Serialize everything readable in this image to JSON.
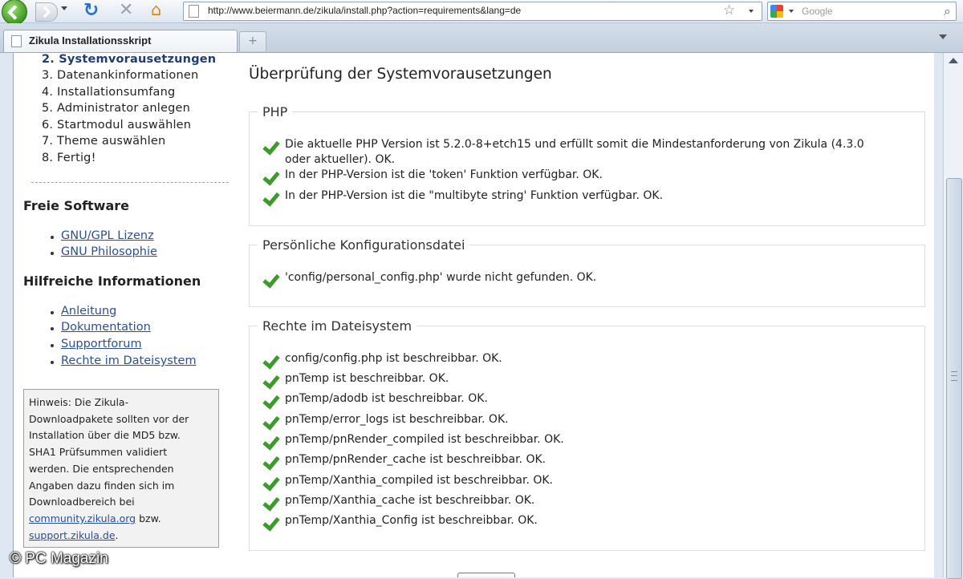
{
  "browser": {
    "url": "http://www.beiermann.de/zikula/install.php?action=requirements&lang=de",
    "search_placeholder": "Google",
    "tab_title": "Zikula Installationsskript",
    "new_tab_symbol": "+"
  },
  "sidebar": {
    "steps": [
      {
        "label": "2. Systemvorausetzungen"
      },
      {
        "label": "3. Datenankinformationen"
      },
      {
        "label": "4. Installationsumfang"
      },
      {
        "label": "5. Administrator anlegen"
      },
      {
        "label": "6. Startmodul auswählen"
      },
      {
        "label": "7. Theme auswählen"
      },
      {
        "label": "8. Fertig!"
      }
    ],
    "free_software": {
      "heading": "Freie Software",
      "links": [
        "GNU/GPL Lizenz",
        "GNU Philosophie"
      ]
    },
    "helpful_info": {
      "heading": "Hilfreiche Informationen",
      "links": [
        "Anleitung",
        "Dokumentation",
        "Supportforum",
        "Rechte im Dateisystem"
      ]
    },
    "note": {
      "lines": [
        "Hinweis: Die Zikula-",
        "Downloadpakete sollten vor der",
        "Installation über die MD5 bzw.",
        "SHA1 Prüfsummen validiert",
        "werden. Die entsprechenden",
        "Angaben dazu finden sich im",
        "Downloadbereich bei"
      ],
      "link1": "community.zikula.org",
      "between": " bzw.",
      "link2": "support.zikula.de",
      "end": "."
    }
  },
  "main": {
    "title": "Überprüfung der Systemvorausetzungen",
    "sections": [
      {
        "legend": "PHP",
        "checks": [
          [
            "Die aktuelle PHP Version ist 5.2.0-8+etch15 und erfüllt somit die Mindestanforderung von Zikula (4.3.0",
            "oder aktueller). OK."
          ],
          [
            "In der PHP-Version ist die 'token' Funktion verfügbar. OK."
          ],
          [
            "In der PHP-Version ist die \"multibyte string' Funktion verfügbar. OK."
          ]
        ]
      },
      {
        "legend": "Persönliche Konfigurationsdatei",
        "checks": [
          [
            "'config/personal_config.php' wurde nicht gefunden. OK."
          ]
        ]
      },
      {
        "legend": "Rechte im Dateisystem",
        "checks": [
          [
            "config/config.php ist beschreibbar. OK."
          ],
          [
            "pnTemp ist beschreibbar. OK."
          ],
          [
            "pnTemp/adodb ist beschreibbar. OK."
          ],
          [
            "pnTemp/error_logs ist beschreibbar. OK."
          ],
          [
            "pnTemp/pnRender_compiled ist beschreibbar. OK."
          ],
          [
            "pnTemp/pnRender_cache ist beschreibbar. OK."
          ],
          [
            "pnTemp/Xanthia_compiled ist beschreibbar. OK."
          ],
          [
            "pnTemp/Xanthia_cache ist beschreibbar. OK."
          ],
          [
            "pnTemp/Xanthia_Config ist beschreibbar. OK."
          ]
        ]
      }
    ]
  },
  "watermark": "© PC Magazin",
  "icons": {
    "check": "green-check-icon",
    "back": "back-arrow-icon",
    "forward": "forward-arrow-icon",
    "reload": "reload-icon",
    "stop": "stop-icon",
    "home": "home-icon",
    "bookmark": "star-icon",
    "search": "magnifier-icon"
  },
  "colors": {
    "link": "#2b4f94",
    "current_step": "#1f3c75",
    "check": "#3d9a2c"
  }
}
